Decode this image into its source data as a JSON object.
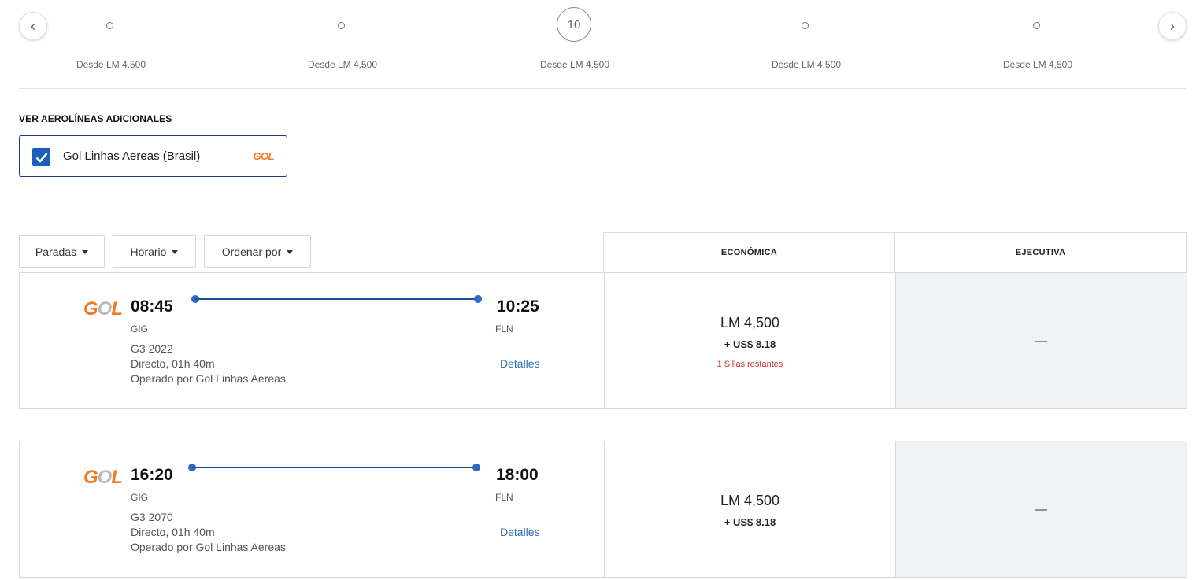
{
  "date_carousel": {
    "prev_icon": "chevron-left-icon",
    "next_icon": "chevron-right-icon",
    "days": [
      {
        "label": "",
        "price": "Desde LM 4,500",
        "selected": false
      },
      {
        "label": "",
        "price": "Desde LM 4,500",
        "selected": false
      },
      {
        "label": "10",
        "price": "Desde LM 4,500",
        "selected": true
      },
      {
        "label": "",
        "price": "Desde LM 4,500",
        "selected": false
      },
      {
        "label": "",
        "price": "Desde LM 4,500",
        "selected": false
      }
    ]
  },
  "airlines": {
    "title": "VER AEROLÍNEAS ADICIONALES",
    "items": [
      {
        "name": "Gol Linhas Aereas (Brasil)",
        "checked": true,
        "logo": "GOL"
      }
    ]
  },
  "filters": {
    "stops": "Paradas",
    "schedule": "Horario",
    "sort": "Ordenar por"
  },
  "columns": {
    "economy": "ECONÓMICA",
    "executive": "EJECUTIVA"
  },
  "flights": [
    {
      "logo": "GOL",
      "depart_time": "08:45",
      "depart_code": "GIG",
      "arrive_time": "10:25",
      "arrive_code": "FLN",
      "flight_number": "G3 2022",
      "duration": "Directo, 01h 40m",
      "operator": "Operado por Gol Linhas Aereas",
      "details": "Detalles",
      "economy": {
        "points": "LM 4,500",
        "usd": "+ US$ 8.18",
        "seats": "1 Sillas restantes"
      },
      "executive": "—"
    },
    {
      "logo": "GOL",
      "depart_time": "16:20",
      "depart_code": "GIG",
      "arrive_time": "18:00",
      "arrive_code": "FLN",
      "flight_number": "G3 2070",
      "duration": "Directo, 01h 40m",
      "operator": "Operado por Gol Linhas Aereas",
      "details": "Detalles",
      "economy": {
        "points": "LM 4,500",
        "usd": "+ US$ 8.18",
        "seats": ""
      },
      "executive": "—"
    }
  ],
  "colors": {
    "accent": "#1c5dbd",
    "gol_orange": "#f47920",
    "link": "#2f6fb5",
    "warning": "#c0392b"
  }
}
